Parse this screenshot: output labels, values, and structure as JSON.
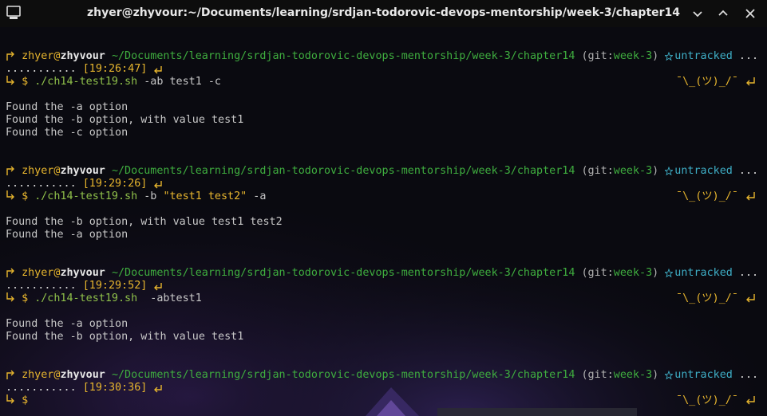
{
  "window": {
    "title": "zhyer@zhyvour:~/Documents/learning/srdjan-todorovic-devops-mentorship/week-3/chapter14"
  },
  "prompt": {
    "user": "zhyer",
    "at": "@",
    "host": "zhyvour",
    "path": "~/Documents/learning/srdjan-todorovic-devops-mentorship/week-3/chapter14",
    "git_open": "(git:",
    "branch": "week-3",
    "git_close": ")",
    "status": "untracked",
    "truncation": "...",
    "dots": "...........",
    "dollar": "$",
    "shrug": "¯\\_(ツ)_/¯"
  },
  "blocks": [
    {
      "time": "[19:26:47]",
      "command": "./ch14-test19.sh",
      "args": " -ab test1 -c",
      "quoted": "",
      "args_after": "",
      "output": [
        "Found the -a option",
        "Found the -b option, with value test1",
        "Found the -c option"
      ]
    },
    {
      "time": "[19:29:26]",
      "command": "./ch14-test19.sh",
      "args": " -b ",
      "quoted": "\"test1 test2\"",
      "args_after": " -a",
      "output": [
        "Found the -b option, with value test1 test2",
        "Found the -a option"
      ]
    },
    {
      "time": "[19:29:52]",
      "command": "./ch14-test19.sh",
      "args": "  -abtest1",
      "quoted": "",
      "args_after": "",
      "output": [
        "Found the -a option",
        "Found the -b option, with value test1"
      ]
    },
    {
      "time": "[19:30:36]",
      "command": "",
      "args": "",
      "quoted": "",
      "args_after": "",
      "output": []
    }
  ],
  "colors": {
    "prompt_yellow": "#e8b62e",
    "path_green": "#3fae3f",
    "status_cyan": "#3fb0c8",
    "command_green": "#8fc04a",
    "text": "#c8c8c8",
    "titlebar_bg": "#0d0d0d"
  },
  "icons": {
    "app": "terminal-icon",
    "minimize": "minimize-icon",
    "maximize": "maximize-icon",
    "close": "close-icon",
    "untracked": "untracked-star-icon",
    "prompt_start": "corner-arrow-icon",
    "prompt_cmd": "corner-down-arrow-icon",
    "time_marker": "return-left-icon",
    "enter": "enter-icon"
  }
}
